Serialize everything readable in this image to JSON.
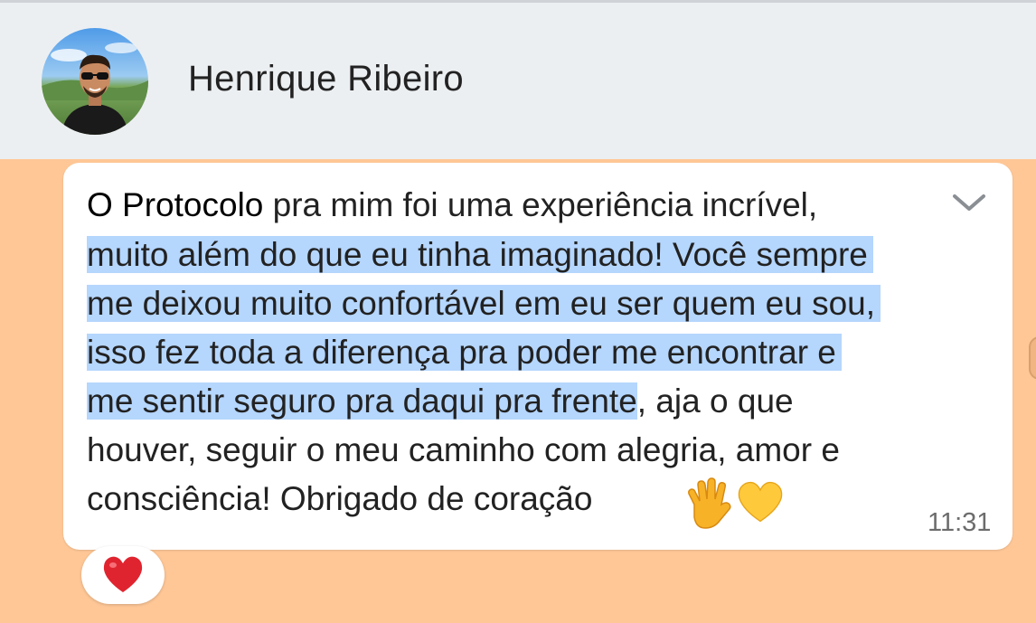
{
  "header": {
    "contact_name": "Henrique Ribeiro",
    "avatar_icon": "profile-photo"
  },
  "message": {
    "lines": [
      {
        "first": "O Protocolo",
        "rest": " pra mim foi uma experiência incrível,",
        "highlighted": ""
      },
      {
        "highlighted": "muito além do que eu tinha imaginado! Você sempre",
        "rest": ""
      },
      {
        "highlighted": "me deixou muito confortável em eu ser quem eu sou,",
        "rest": ""
      },
      {
        "highlighted": "isso fez toda a diferença pra poder me encontrar e",
        "rest": ""
      },
      {
        "highlighted": "me sentir seguro pra daqui pra frente",
        "rest": ", aja o que"
      },
      {
        "highlighted": "",
        "rest": "houver, seguir o meu caminho com alegria, amor e"
      },
      {
        "highlighted": "",
        "rest": "consciência! Obrigado de coração"
      }
    ],
    "emojis": [
      "raised-hand-emoji",
      "yellow-heart-emoji"
    ],
    "time": "11:31",
    "menu_icon": "chevron-down-icon",
    "highlight_color": "#b5d6fd"
  },
  "reaction": {
    "icon": "red-heart-icon",
    "color": "#e0242f"
  },
  "colors": {
    "chat_background": "#ffc796",
    "header_background": "#eceff2",
    "bubble_background": "#ffffff"
  }
}
